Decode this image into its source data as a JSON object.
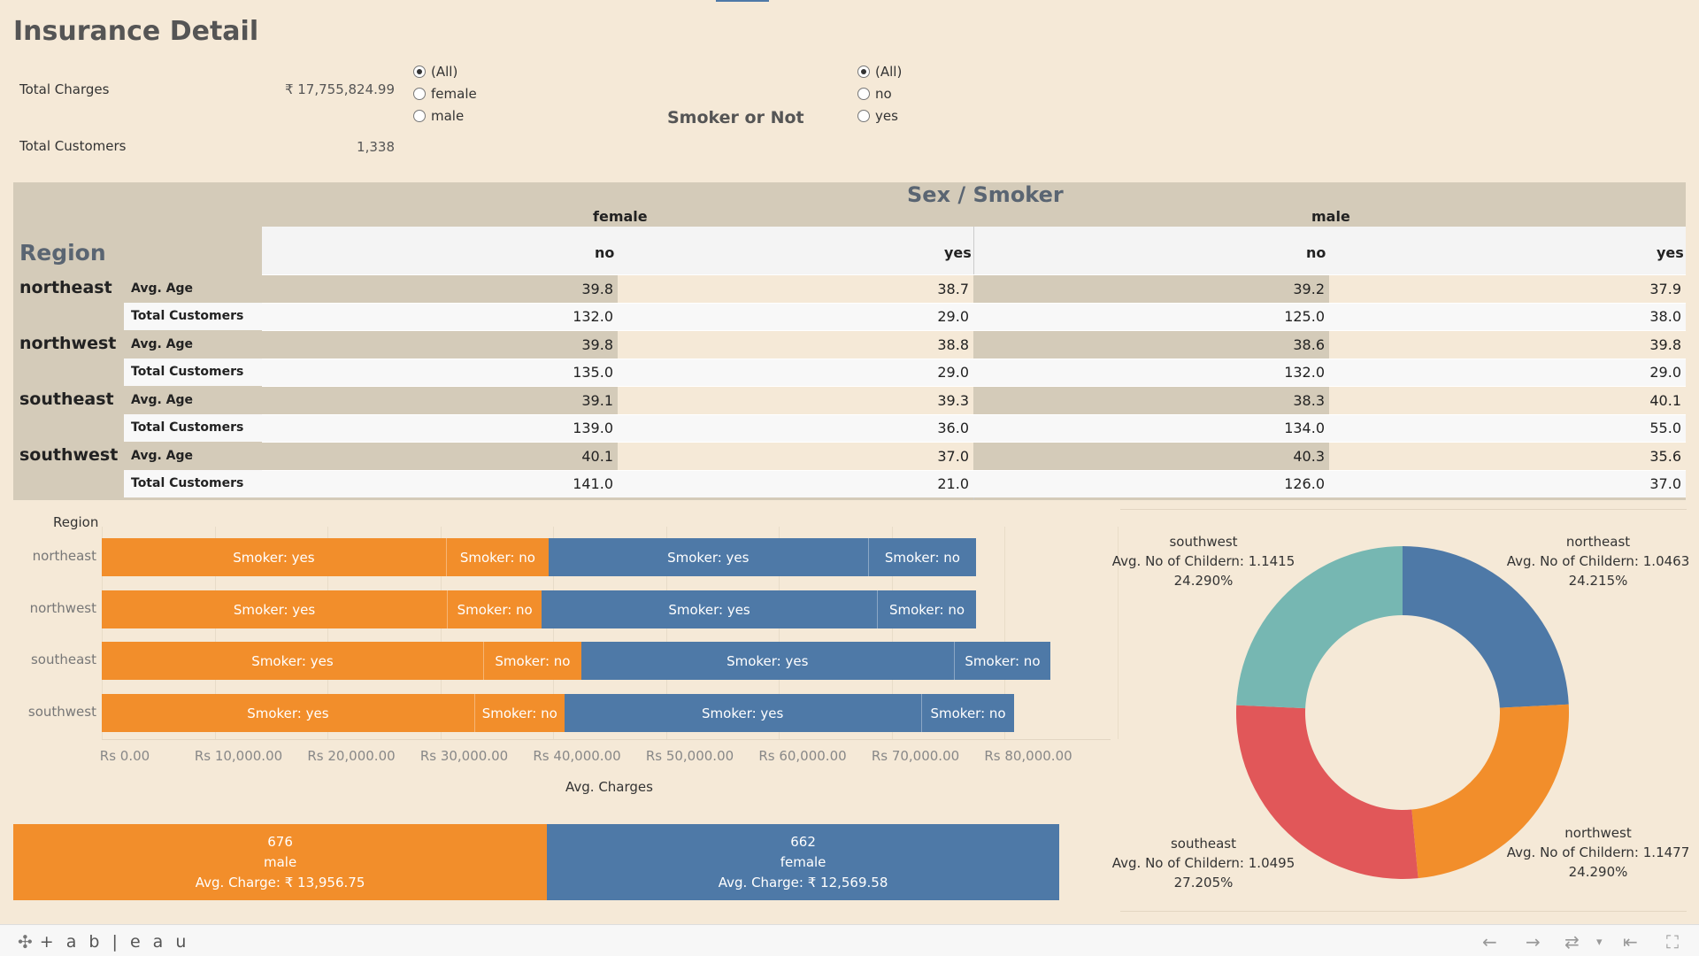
{
  "title": "Insurance Detail",
  "kpis": {
    "total_charges_label": "Total Charges",
    "total_charges_value": "₹ 17,755,824.99",
    "total_customers_label": "Total Customers",
    "total_customers_value": "1,338"
  },
  "filters": {
    "sex": {
      "options": [
        "(All)",
        "female",
        "male"
      ],
      "selected": "(All)"
    },
    "smoker": {
      "title": "Smoker or Not",
      "options": [
        "(All)",
        "no",
        "yes"
      ],
      "selected": "(All)"
    }
  },
  "crosstab": {
    "title": "Sex / Smoker",
    "row_header": "Region",
    "sexes": [
      "female",
      "male"
    ],
    "smokers": [
      "no",
      "yes"
    ],
    "measures": [
      "Avg. Age",
      "Total Customers"
    ],
    "rows": [
      {
        "region": "northeast",
        "avg_age": [
          "39.8",
          "38.7",
          "39.2",
          "37.9"
        ],
        "total_customers": [
          "132.0",
          "29.0",
          "125.0",
          "38.0"
        ]
      },
      {
        "region": "northwest",
        "avg_age": [
          "39.8",
          "38.8",
          "38.6",
          "39.8"
        ],
        "total_customers": [
          "135.0",
          "29.0",
          "132.0",
          "29.0"
        ]
      },
      {
        "region": "southeast",
        "avg_age": [
          "39.1",
          "39.3",
          "38.3",
          "40.1"
        ],
        "total_customers": [
          "139.0",
          "36.0",
          "134.0",
          "55.0"
        ]
      },
      {
        "region": "southwest",
        "avg_age": [
          "40.1",
          "37.0",
          "40.3",
          "35.6"
        ],
        "total_customers": [
          "141.0",
          "21.0",
          "126.0",
          "37.0"
        ]
      }
    ]
  },
  "chart_data": [
    {
      "type": "bar",
      "orientation": "horizontal",
      "stacked": true,
      "ylabel": "Region",
      "xlabel": "Avg. Charges",
      "categories": [
        "northeast",
        "northwest",
        "southeast",
        "southwest"
      ],
      "series": [
        {
          "sex": "female",
          "smoker": "yes",
          "label": "Smoker: yes",
          "color": "#f28e2b",
          "values": [
            30500,
            30600,
            33800,
            33000
          ]
        },
        {
          "sex": "female",
          "smoker": "no",
          "label": "Smoker: no",
          "color": "#f28e2b",
          "values": [
            9100,
            8400,
            8700,
            8000
          ]
        },
        {
          "sex": "male",
          "smoker": "yes",
          "label": "Smoker: yes",
          "color": "#4e79a7",
          "values": [
            28300,
            29700,
            33000,
            31600
          ]
        },
        {
          "sex": "male",
          "smoker": "no",
          "label": "Smoker: no",
          "color": "#4e79a7",
          "values": [
            9600,
            8800,
            8600,
            8300
          ]
        }
      ],
      "xticks": [
        "Rs 0.00",
        "Rs 10,000.00",
        "Rs 20,000.00",
        "Rs 30,000.00",
        "Rs 40,000.00",
        "Rs 50,000.00",
        "Rs 60,000.00",
        "Rs 70,000.00",
        "Rs 80,000.00"
      ],
      "xlim": [
        0,
        80000
      ]
    },
    {
      "type": "bar",
      "orientation": "horizontal",
      "stacked": true,
      "categories": [
        "male",
        "female"
      ],
      "values": [
        676,
        662
      ],
      "charges": [
        "Avg. Charge: ₹ 13,956.75",
        "Avg. Charge: ₹ 12,569.58"
      ],
      "counts": [
        "676",
        "662"
      ],
      "colors": [
        "#f28e2b",
        "#4e79a7"
      ]
    },
    {
      "type": "pie",
      "donut": true,
      "slices": [
        {
          "region": "northeast",
          "line": "Avg. No of Childern: 1.0463",
          "pct_label": "24.215%",
          "value": 24.215,
          "color": "#4e79a7"
        },
        {
          "region": "northwest",
          "line": "Avg. No of Childern: 1.1477",
          "pct_label": "24.290%",
          "value": 24.29,
          "color": "#f28e2b"
        },
        {
          "region": "southeast",
          "line": "Avg. No of Childern: 1.0495",
          "pct_label": "27.205%",
          "value": 27.205,
          "color": "#e15759"
        },
        {
          "region": "southwest",
          "line": "Avg. No of Childern: 1.1415",
          "pct_label": "24.290%",
          "value": 24.29,
          "color": "#76b7b2"
        }
      ]
    }
  ],
  "footer": {
    "brand": "+ a b | e a u"
  }
}
